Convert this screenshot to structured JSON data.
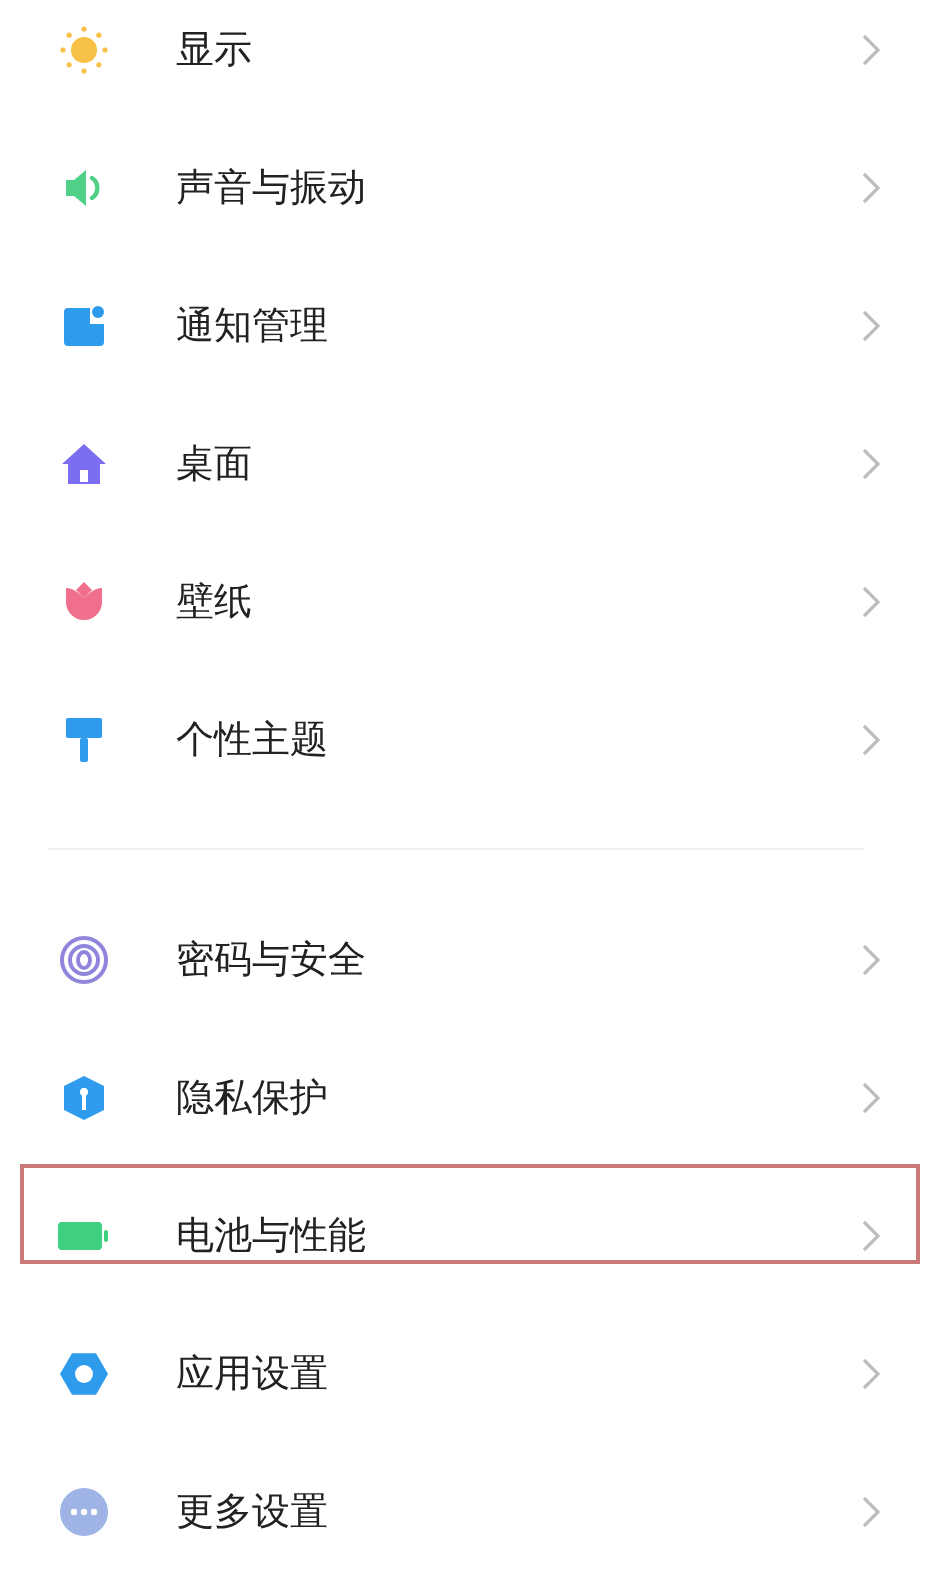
{
  "sections": [
    {
      "items": [
        {
          "label": "显示",
          "highlighted": false
        },
        {
          "label": "声音与振动",
          "highlighted": false
        },
        {
          "label": "通知管理",
          "highlighted": false
        },
        {
          "label": "桌面",
          "highlighted": false
        },
        {
          "label": "壁纸",
          "highlighted": false
        },
        {
          "label": "个性主题",
          "highlighted": false
        }
      ]
    },
    {
      "items": [
        {
          "label": "密码与安全",
          "highlighted": false
        },
        {
          "label": "隐私保护",
          "highlighted": false
        },
        {
          "label": "电池与性能",
          "highlighted": true
        },
        {
          "label": "应用设置",
          "highlighted": false
        },
        {
          "label": "更多设置",
          "highlighted": false
        }
      ]
    }
  ]
}
